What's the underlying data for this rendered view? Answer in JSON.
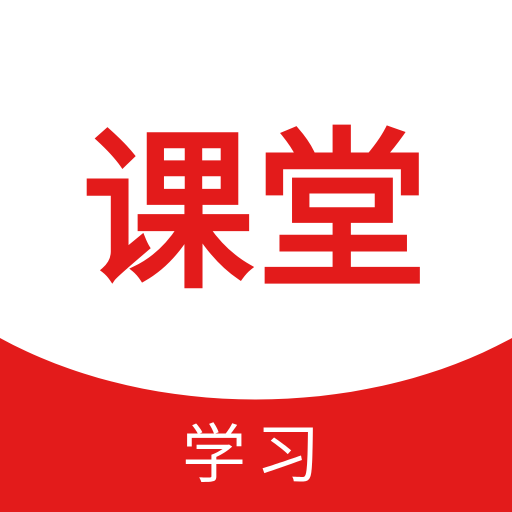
{
  "icon": {
    "title": "课堂",
    "subtitle": "学习"
  },
  "colors": {
    "background": "#ffffff",
    "brand_red": "#e31b1b",
    "title_text": "#e31b1b",
    "subtitle_text": "#ffffff"
  }
}
